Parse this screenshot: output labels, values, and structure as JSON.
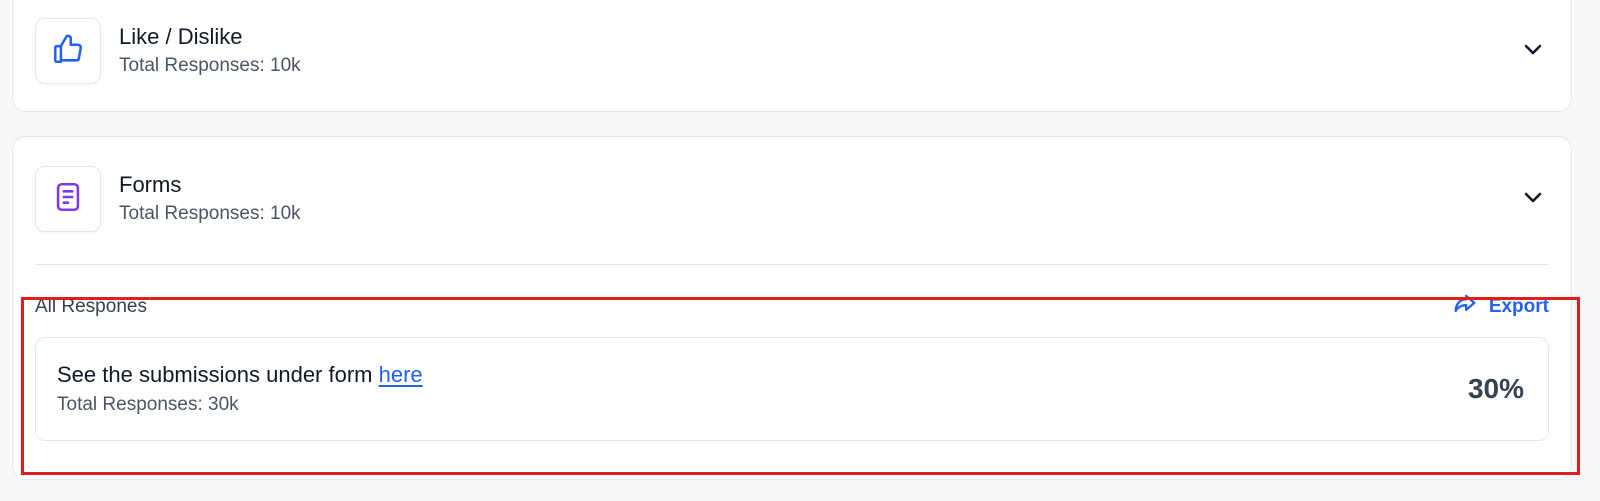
{
  "like_dislike": {
    "title": "Like / Dislike",
    "subtitle": "Total Responses: 10k",
    "icon": "thumbs-up-icon",
    "icon_color": "#2563eb"
  },
  "forms": {
    "title": "Forms",
    "subtitle": "Total Responses: 10k",
    "icon": "form-icon",
    "icon_color": "#7c3aed"
  },
  "all_responses": {
    "title": "All Respones",
    "export_label": "Export",
    "export_icon": "share-icon",
    "submission_prefix": "See the submissions under form ",
    "submission_link": "here",
    "submission_subtitle": "Total Responses: 30k",
    "percent": "30%"
  },
  "colors": {
    "accent": "#2563eb",
    "form_icon": "#7c3aed",
    "highlight": "#e11d1d"
  }
}
